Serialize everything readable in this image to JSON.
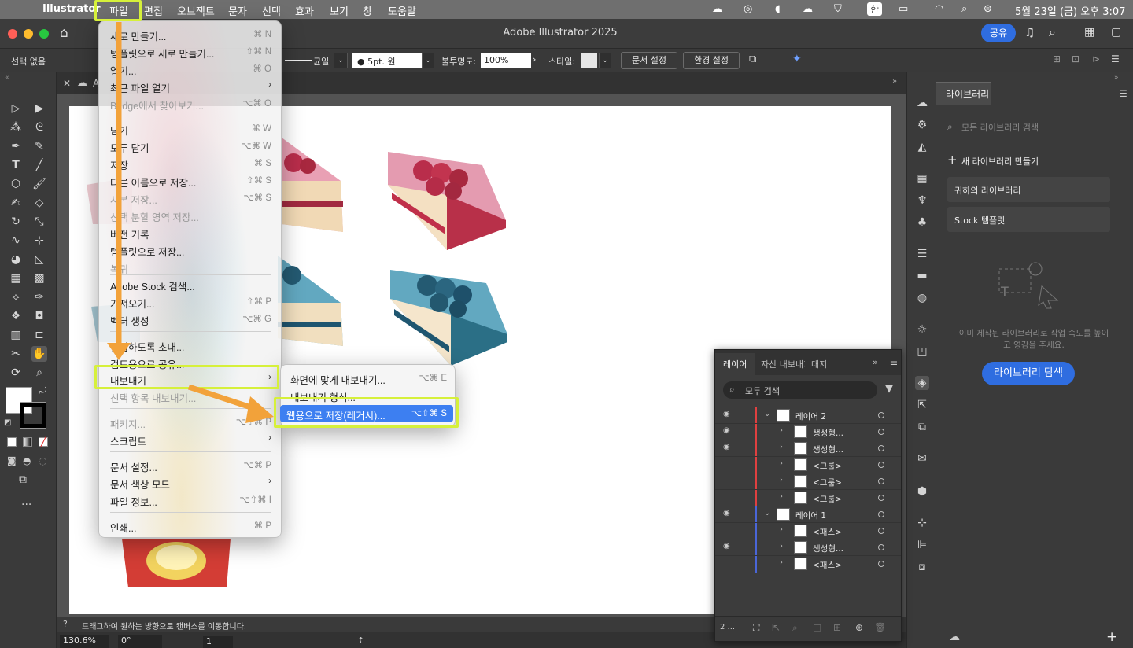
{
  "mac_menubar": {
    "apple": "",
    "app": "Illustrator",
    "menus": [
      "파일",
      "편집",
      "오브젝트",
      "문자",
      "선택",
      "효과",
      "보기",
      "창",
      "도움말"
    ],
    "input_source": "한",
    "datetime": "5월 23일 (금) 오후 3:07"
  },
  "titlebar": {
    "title": "Adobe Illustrator 2025",
    "share": "공유"
  },
  "control_bar": {
    "selection": "선택 없음",
    "stroke_profile": "균일",
    "brush": "5pt. 원",
    "opacity_label": "불투명도:",
    "opacity_value": "100%",
    "style_label": "스타일:",
    "doc_setup": "문서 설정",
    "preferences": "환경 설정"
  },
  "doc_tab": {
    "title": "A"
  },
  "file_menu": {
    "items": [
      {
        "label": "새로 만들기...",
        "shortcut": "⌘ N",
        "disabled": false,
        "arrow": false
      },
      {
        "label": "템플릿으로 새로 만들기...",
        "shortcut": "⇧⌘ N",
        "disabled": false,
        "arrow": false
      },
      {
        "label": "열기...",
        "shortcut": "⌘ O",
        "disabled": false,
        "arrow": false
      },
      {
        "label": "최근 파일 열기",
        "shortcut": "",
        "disabled": false,
        "arrow": true
      },
      {
        "label": "Bridge에서 찾아보기...",
        "shortcut": "⌥⌘ O",
        "disabled": true,
        "arrow": false
      },
      {
        "label": "닫기",
        "shortcut": "⌘ W",
        "disabled": false,
        "arrow": false
      },
      {
        "label": "모두 닫기",
        "shortcut": "⌥⌘ W",
        "disabled": false,
        "arrow": false
      },
      {
        "label": "저장",
        "shortcut": "⌘ S",
        "disabled": false,
        "arrow": false
      },
      {
        "label": "다른 이름으로 저장...",
        "shortcut": "⇧⌘ S",
        "disabled": false,
        "arrow": false
      },
      {
        "label": "사본 저장...",
        "shortcut": "⌥⌘ S",
        "disabled": true,
        "arrow": false
      },
      {
        "label": "선택 분할 영역 저장...",
        "shortcut": "",
        "disabled": true,
        "arrow": false
      },
      {
        "label": "버전 기록",
        "shortcut": "",
        "disabled": false,
        "arrow": false
      },
      {
        "label": "템플릿으로 저장...",
        "shortcut": "",
        "disabled": false,
        "arrow": false
      },
      {
        "label": "복귀",
        "shortcut": "",
        "disabled": true,
        "arrow": false
      },
      {
        "label": "Adobe Stock 검색...",
        "shortcut": "",
        "disabled": false,
        "arrow": false
      },
      {
        "label": "가져오기...",
        "shortcut": "⇧⌘ P",
        "disabled": false,
        "arrow": false
      },
      {
        "label": "벡터 생성",
        "shortcut": "⌥⌘ G",
        "disabled": false,
        "arrow": false
      },
      {
        "label": "편집하도록 초대...",
        "shortcut": "",
        "disabled": false,
        "arrow": false
      },
      {
        "label": "검토용으로 공유...",
        "shortcut": "",
        "disabled": false,
        "arrow": false
      },
      {
        "label": "내보내기",
        "shortcut": "",
        "disabled": false,
        "arrow": true
      },
      {
        "label": "선택 항목 내보내기...",
        "shortcut": "",
        "disabled": true,
        "arrow": false
      },
      {
        "label": "패키지...",
        "shortcut": "⌥⇧⌘ P",
        "disabled": true,
        "arrow": false
      },
      {
        "label": "스크립트",
        "shortcut": "",
        "disabled": false,
        "arrow": true
      },
      {
        "label": "문서 설정...",
        "shortcut": "⌥⌘ P",
        "disabled": false,
        "arrow": false
      },
      {
        "label": "문서 색상 모드",
        "shortcut": "",
        "disabled": false,
        "arrow": true
      },
      {
        "label": "파일 정보...",
        "shortcut": "⌥⇧⌘ I",
        "disabled": false,
        "arrow": false
      },
      {
        "label": "인쇄...",
        "shortcut": "⌘ P",
        "disabled": false,
        "arrow": false
      }
    ]
  },
  "export_submenu": {
    "items": [
      {
        "label": "화면에 맞게 내보내기...",
        "shortcut": "⌥⌘ E"
      },
      {
        "label": "내보내기 형식...",
        "shortcut": ""
      },
      {
        "label": "웹용으로 저장(레거시)...",
        "shortcut": "⌥⇧⌘ S"
      }
    ]
  },
  "layers_panel": {
    "tabs": [
      "레이어",
      "자산 내보내기",
      "대지"
    ],
    "search_placeholder": "모두 검색",
    "rows": [
      {
        "name": "레이어 2",
        "eye": true,
        "color": "#e04040",
        "level": 0,
        "expanded": true
      },
      {
        "name": "생성형...",
        "eye": true,
        "color": "#e04040",
        "level": 1,
        "expanded": false
      },
      {
        "name": "생성형...",
        "eye": true,
        "color": "#e04040",
        "level": 1,
        "expanded": false
      },
      {
        "name": "<그룹>",
        "eye": false,
        "color": "#e04040",
        "level": 1,
        "expanded": false
      },
      {
        "name": "<그룹>",
        "eye": false,
        "color": "#e04040",
        "level": 1,
        "expanded": false
      },
      {
        "name": "<그룹>",
        "eye": false,
        "color": "#e04040",
        "level": 1,
        "expanded": false
      },
      {
        "name": "레이어 1",
        "eye": true,
        "color": "#4a66d8",
        "level": 0,
        "expanded": true
      },
      {
        "name": "<패스>",
        "eye": false,
        "color": "#4a66d8",
        "level": 1,
        "expanded": false
      },
      {
        "name": "생성형...",
        "eye": true,
        "color": "#4a66d8",
        "level": 1,
        "expanded": false
      },
      {
        "name": "<패스>",
        "eye": false,
        "color": "#4a66d8",
        "level": 1,
        "expanded": false
      }
    ],
    "footer_count": "2 ..."
  },
  "library_panel": {
    "title": "라이브러리",
    "search_placeholder": "모든 라이브러리 검색",
    "new_library": "새 라이브러리 만들기",
    "libraries": [
      "귀하의 라이브러리",
      "Stock 템플릿"
    ],
    "empty_text": "이미 제작된 라이브러리로 작업 속도를 높이고 영감을 주세요.",
    "browse_button": "라이브러리 탐색"
  },
  "status": {
    "hint": "드래그하여 원하는 방향으로 캔버스를 이동합니다.",
    "zoom": "130.6%",
    "rotation": "0°",
    "artboard": "1"
  },
  "colors": {
    "highlight": "#d6f03a",
    "arrow": "#f2a23a",
    "accent": "#2f6de0",
    "menu_selected": "#3d7ff1"
  }
}
